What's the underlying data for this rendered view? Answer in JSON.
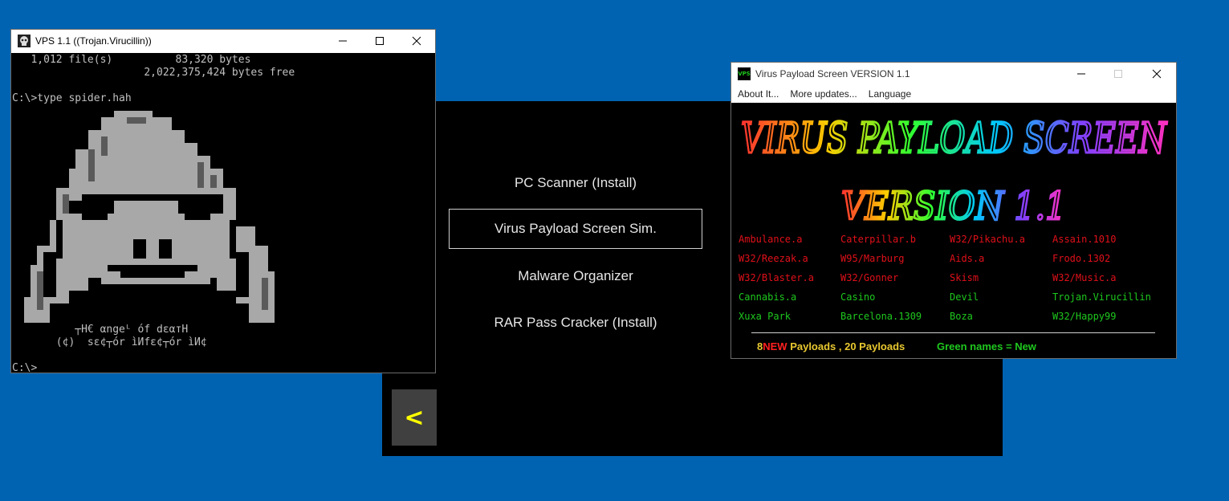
{
  "launcher": {
    "items": [
      {
        "label": "PC Scanner (Install)"
      },
      {
        "label": "Virus Payload Screen Sim."
      },
      {
        "label": "Malware Organizer"
      },
      {
        "label": "RAR Pass Cracker (Install)"
      }
    ],
    "back_label": "<"
  },
  "console": {
    "title": "VPS 1.1 ((Trojan.Virucillin))",
    "lines": {
      "files": "   1,012 file(s)          83,320 bytes",
      "free": "                     2,022,375,424 bytes free",
      "cmd": "C:\\>type spider.hah",
      "credits1": "          ┬H€ αngeᴸ óf dεαтH",
      "credits2": "       (¢)  sε¢┬ór ìИfε¢┬ór ìИ¢",
      "prompt": "C:\\>"
    }
  },
  "vps": {
    "title": "Virus Payload Screen VERSION 1.1",
    "icon_text": "VPS",
    "menu": [
      "About It...",
      "More updates...",
      "Language"
    ],
    "logo_line1": "VIRUS PAYLOAD SCREEN",
    "logo_line2": "VERSION 1.1",
    "payloads": [
      [
        "Ambulance.a",
        "Caterpillar.b",
        "W32/Pikachu.a",
        "Assain.1010"
      ],
      [
        "W32/Reezak.a",
        "W95/Marburg",
        "Aids.a",
        "Frodo.1302"
      ],
      [
        "W32/Blaster.a",
        "W32/Gonner",
        "Skism",
        "W32/Music.a"
      ],
      [
        "Cannabis.a",
        "Casino",
        "Devil",
        "Trojan.Virucillin"
      ],
      [
        "Xuxa Park",
        "Barcelona.1309",
        "Boza",
        "W32/Happy99"
      ]
    ],
    "payload_colors": [
      [
        "red",
        "red",
        "red",
        "red"
      ],
      [
        "red",
        "red",
        "red",
        "red"
      ],
      [
        "red",
        "red",
        "red",
        "red"
      ],
      [
        "grn",
        "grn",
        "grn",
        "grn"
      ],
      [
        "grn",
        "grn",
        "grn",
        "grn"
      ]
    ],
    "footer": {
      "new_count": "8",
      "new_word": "NEW",
      "payloads_text": " Payloads , 20 Payloads",
      "green_note": "Green names = New"
    }
  },
  "colors": {
    "desktop": "#0063b1",
    "accent_yellow": "#ffff00",
    "payload_red": "#e0101a",
    "payload_green": "#1ec81e",
    "footer_yellow": "#e8c830",
    "footer_new_red": "#ff2020"
  }
}
